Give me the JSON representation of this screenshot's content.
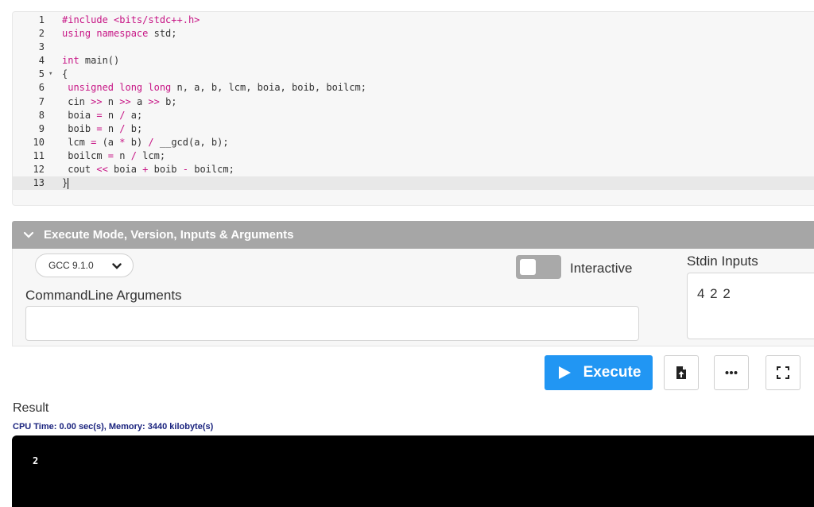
{
  "editor": {
    "lines": [
      {
        "no": "1",
        "fold": "",
        "tokens": [
          {
            "t": "#include <bits/stdc++.h>",
            "c": "kw"
          }
        ]
      },
      {
        "no": "2",
        "fold": "",
        "tokens": [
          {
            "t": "using namespace",
            "c": "kw"
          },
          {
            "t": " std;",
            "c": ""
          }
        ]
      },
      {
        "no": "3",
        "fold": "",
        "tokens": []
      },
      {
        "no": "4",
        "fold": "",
        "tokens": [
          {
            "t": "int",
            "c": "kw"
          },
          {
            "t": " main()",
            "c": ""
          }
        ]
      },
      {
        "no": "5",
        "fold": "▾",
        "tokens": [
          {
            "t": "{",
            "c": ""
          }
        ]
      },
      {
        "no": "6",
        "fold": "",
        "tokens": [
          {
            "t": " ",
            "c": ""
          },
          {
            "t": "unsigned long long",
            "c": "kw"
          },
          {
            "t": " n, a, b, lcm, boia, boib, boilcm;",
            "c": ""
          }
        ]
      },
      {
        "no": "7",
        "fold": "",
        "tokens": [
          {
            "t": " cin ",
            "c": ""
          },
          {
            "t": ">>",
            "c": "op"
          },
          {
            "t": " n ",
            "c": ""
          },
          {
            "t": ">>",
            "c": "op"
          },
          {
            "t": " a ",
            "c": ""
          },
          {
            "t": ">>",
            "c": "op"
          },
          {
            "t": " b;",
            "c": ""
          }
        ]
      },
      {
        "no": "8",
        "fold": "",
        "tokens": [
          {
            "t": " boia ",
            "c": ""
          },
          {
            "t": "=",
            "c": "op"
          },
          {
            "t": " n ",
            "c": ""
          },
          {
            "t": "/",
            "c": "op"
          },
          {
            "t": " a;",
            "c": ""
          }
        ]
      },
      {
        "no": "9",
        "fold": "",
        "tokens": [
          {
            "t": " boib ",
            "c": ""
          },
          {
            "t": "=",
            "c": "op"
          },
          {
            "t": " n ",
            "c": ""
          },
          {
            "t": "/",
            "c": "op"
          },
          {
            "t": " b;",
            "c": ""
          }
        ]
      },
      {
        "no": "10",
        "fold": "",
        "tokens": [
          {
            "t": " lcm ",
            "c": ""
          },
          {
            "t": "=",
            "c": "op"
          },
          {
            "t": " (a ",
            "c": ""
          },
          {
            "t": "*",
            "c": "op"
          },
          {
            "t": " b) ",
            "c": ""
          },
          {
            "t": "/",
            "c": "op"
          },
          {
            "t": " __gcd(a, b);",
            "c": ""
          }
        ]
      },
      {
        "no": "11",
        "fold": "",
        "tokens": [
          {
            "t": " boilcm ",
            "c": ""
          },
          {
            "t": "=",
            "c": "op"
          },
          {
            "t": " n ",
            "c": ""
          },
          {
            "t": "/",
            "c": "op"
          },
          {
            "t": " lcm;",
            "c": ""
          }
        ]
      },
      {
        "no": "12",
        "fold": "",
        "tokens": [
          {
            "t": " cout ",
            "c": ""
          },
          {
            "t": "<<",
            "c": "op"
          },
          {
            "t": " boia ",
            "c": ""
          },
          {
            "t": "+",
            "c": "op"
          },
          {
            "t": " boib ",
            "c": ""
          },
          {
            "t": "-",
            "c": "op"
          },
          {
            "t": " boilcm;",
            "c": ""
          }
        ]
      },
      {
        "no": "13",
        "fold": "",
        "tokens": [
          {
            "t": "}",
            "c": ""
          }
        ],
        "active": true
      }
    ]
  },
  "execute_panel": {
    "title": "Execute Mode, Version, Inputs & Arguments",
    "version": "GCC 9.1.0",
    "interactive_label": "Interactive",
    "interactive_on": false,
    "cmd_args_label": "CommandLine Arguments",
    "cmd_args_value": "",
    "stdin_label": "Stdin Inputs",
    "stdin_value": "4 2 2"
  },
  "actions": {
    "execute_label": "Execute",
    "icons": [
      "play-icon",
      "upload-file-icon",
      "more-icon",
      "fullscreen-icon"
    ]
  },
  "result": {
    "label": "Result",
    "stats": "CPU Time: 0.00 sec(s), Memory: 3440 kilobyte(s)",
    "output": "2"
  },
  "colors": {
    "execute_button": "#2196f3",
    "panel_header": "#a6a6a6",
    "keyword": "#c71585",
    "stats_text": "#1a237e",
    "output_background": "#000000"
  }
}
